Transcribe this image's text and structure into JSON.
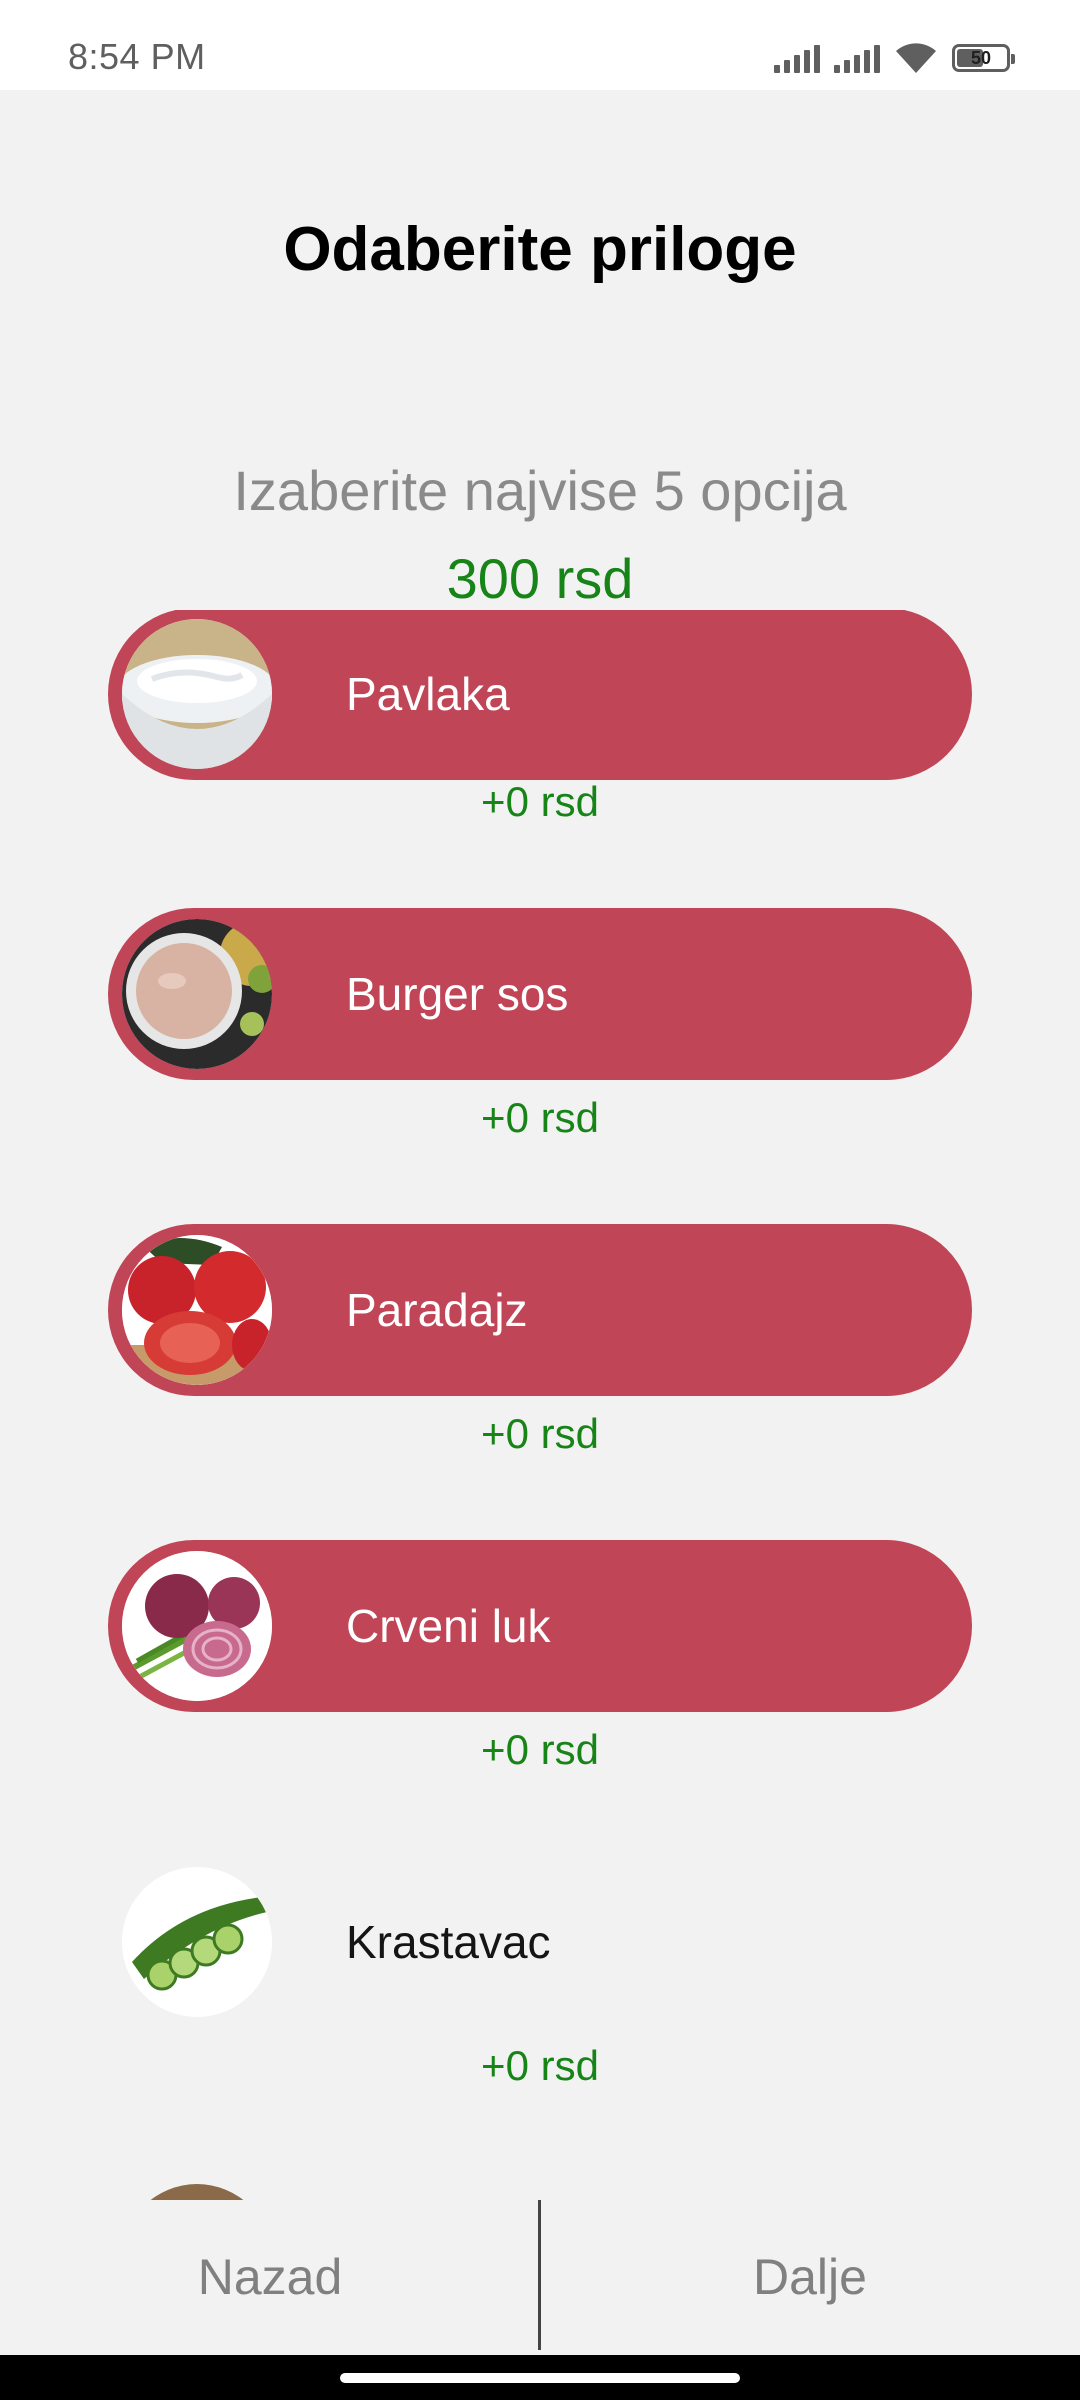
{
  "status_bar": {
    "time": "8:54 PM",
    "battery": "50"
  },
  "header": {
    "title": "Odaberite priloge",
    "subtitle": "Izaberite najvise 5 opcija",
    "base_price": "300 rsd"
  },
  "items": [
    {
      "label": "Pavlaka",
      "price": "+0 rsd",
      "selected": true,
      "icon": "sour-cream-icon"
    },
    {
      "label": "Burger sos",
      "price": "+0 rsd",
      "selected": true,
      "icon": "burger-sauce-icon"
    },
    {
      "label": "Paradajz",
      "price": "+0 rsd",
      "selected": true,
      "icon": "tomato-icon"
    },
    {
      "label": "Crveni luk",
      "price": "+0 rsd",
      "selected": true,
      "icon": "red-onion-icon"
    },
    {
      "label": "Krastavac",
      "price": "+0 rsd",
      "selected": false,
      "icon": "cucumber-icon"
    }
  ],
  "footer": {
    "back_label": "Nazad",
    "next_label": "Dalje"
  },
  "colors": {
    "accent": "#c04557",
    "price": "#178417",
    "background": "#f3f2f2"
  }
}
